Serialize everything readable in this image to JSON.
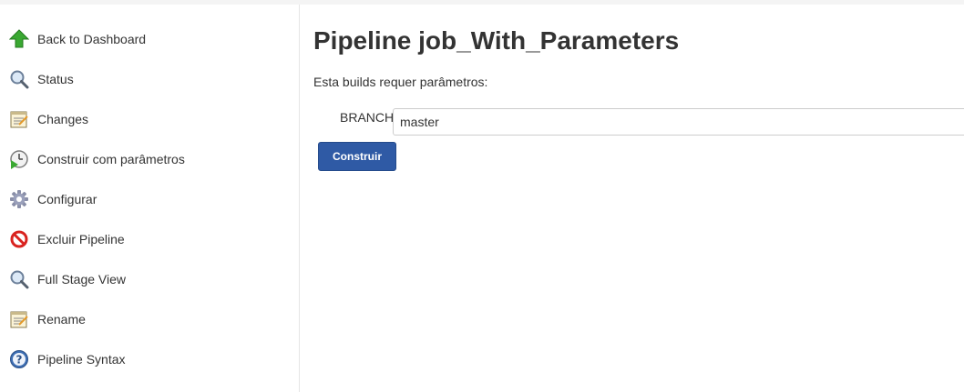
{
  "sidebar": {
    "items": [
      {
        "label": "Back to Dashboard",
        "icon": "up-arrow-icon"
      },
      {
        "label": "Status",
        "icon": "magnifier-icon"
      },
      {
        "label": "Changes",
        "icon": "notepad-icon"
      },
      {
        "label": "Construir com parâmetros",
        "icon": "clock-play-icon"
      },
      {
        "label": "Configurar",
        "icon": "gear-icon"
      },
      {
        "label": "Excluir Pipeline",
        "icon": "no-entry-icon"
      },
      {
        "label": "Full Stage View",
        "icon": "magnifier-icon"
      },
      {
        "label": "Rename",
        "icon": "notepad-icon"
      },
      {
        "label": "Pipeline Syntax",
        "icon": "help-icon"
      }
    ]
  },
  "main": {
    "title": "Pipeline job_With_Parameters",
    "description": "Esta builds requer parâmetros:",
    "parameter": {
      "name": "BRANCH",
      "value": "master"
    },
    "build_button": "Construir"
  },
  "colors": {
    "button": "#2f5aa5",
    "arrow_green": "#3aa832",
    "no_entry_red": "#d9231f",
    "help_blue": "#3e6fb4"
  }
}
